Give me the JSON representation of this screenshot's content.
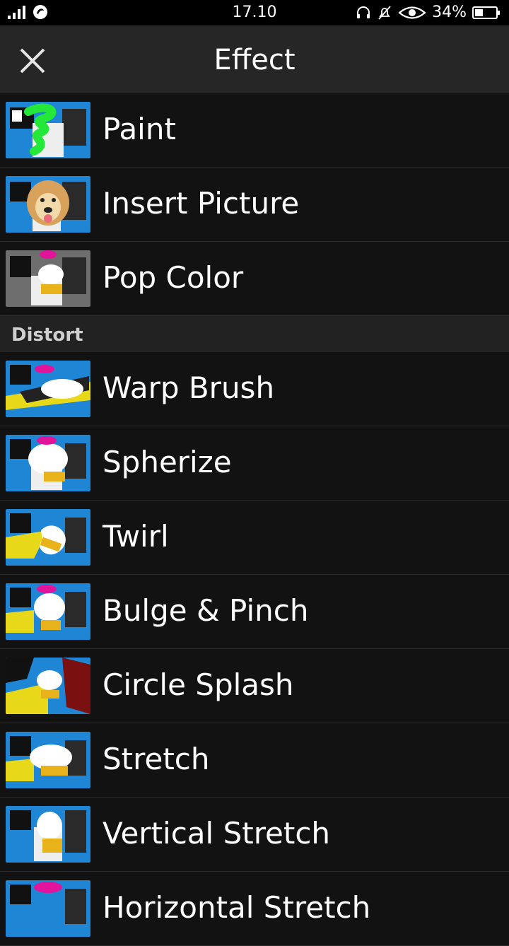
{
  "status_bar": {
    "time": "17.10",
    "battery": "34%"
  },
  "appbar": {
    "title": "Effect"
  },
  "items_top": [
    {
      "label": "Paint",
      "thumb": "paint"
    },
    {
      "label": "Insert Picture",
      "thumb": "dog"
    },
    {
      "label": "Pop Color",
      "thumb": "grey"
    }
  ],
  "section": {
    "title": "Distort"
  },
  "items_distort": [
    {
      "label": "Warp Brush"
    },
    {
      "label": "Spherize"
    },
    {
      "label": "Twirl"
    },
    {
      "label": "Bulge & Pinch"
    },
    {
      "label": "Circle Splash"
    },
    {
      "label": "Stretch"
    },
    {
      "label": "Vertical Stretch"
    },
    {
      "label": "Horizontal Stretch"
    }
  ],
  "colors": {
    "thumb_bg": "#1f86d6",
    "thumb_grey": "#6e6e6e"
  }
}
